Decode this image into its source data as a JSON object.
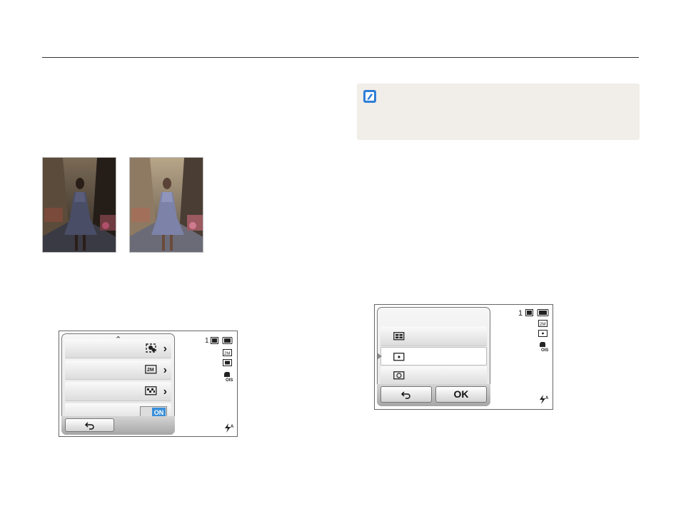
{
  "left_screen": {
    "toggle_value": "ON",
    "status_count": "1"
  },
  "right_screen": {
    "status_count": "1",
    "ok_label": "OK"
  },
  "colors": {
    "note_bg": "#f1ede8",
    "toggle_on": "#3a8fd9",
    "rule": "#333333"
  },
  "icons": [
    "note-icon",
    "face-detect-icon",
    "resolution-icon",
    "quality-icon",
    "back-arrow-icon",
    "metering-multi-icon",
    "metering-spot-icon",
    "metering-center-icon",
    "flash-auto-icon",
    "ois-icon",
    "battery-icon",
    "memory-card-icon"
  ]
}
